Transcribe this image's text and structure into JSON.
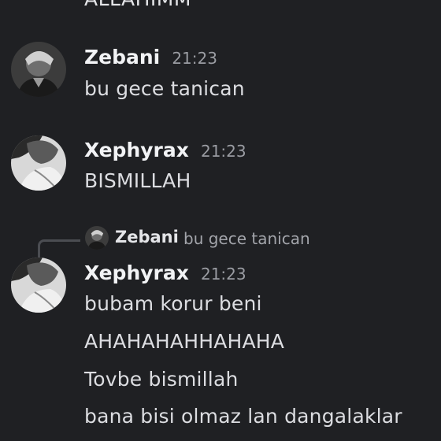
{
  "chat": {
    "cut_off_text": "ALLAHIMM",
    "messages": [
      {
        "username": "Zebani",
        "timestamp": "21:23",
        "lines": [
          "bu gece tanican"
        ]
      },
      {
        "username": "Xephyrax",
        "timestamp": "21:23",
        "lines": [
          "BISMILLAH"
        ]
      },
      {
        "reply_to": {
          "username": "Zebani",
          "text": "bu gece tanican"
        },
        "username": "Xephyrax",
        "timestamp": "21:23",
        "lines": [
          "bubam korur beni",
          "AHAHAHAHHAHAHA",
          "Tovbe bismillah",
          "bana bisi olmaz lan dangalaklar"
        ]
      }
    ]
  },
  "colors": {
    "background": "#1f2023",
    "username": "#f2f3f5",
    "timestamp": "#9a9ca2",
    "message_text": "#dcdde1",
    "reply_text": "#a3a5ab",
    "reply_spine": "#4b4d52"
  },
  "icons": [
    "avatar-zebani",
    "avatar-xephyrax"
  ]
}
